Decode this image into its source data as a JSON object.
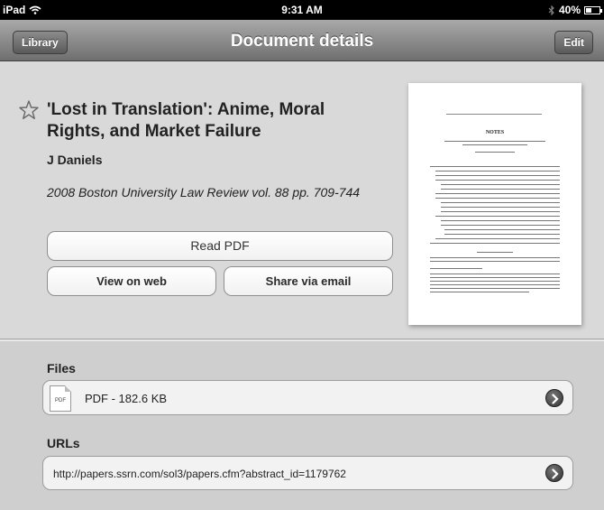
{
  "status_bar": {
    "device": "iPad",
    "time": "9:31 AM",
    "battery_text": "40%",
    "battery_level": 0.4
  },
  "nav": {
    "title": "Document details",
    "left_button": "Library",
    "right_button": "Edit"
  },
  "document": {
    "title": "'Lost in Translation': Anime, Moral Rights, and Market Failure",
    "author": "J Daniels",
    "source": "2008 Boston University Law Review vol. 88 pp. 709-744",
    "thumbnail_heading": "NOTES"
  },
  "actions": {
    "read_pdf": "Read PDF",
    "view_web": "View on web",
    "share_email": "Share via email"
  },
  "files": {
    "label": "Files",
    "items": [
      {
        "icon_text": "PDF",
        "text": "PDF - 182.6 KB"
      }
    ]
  },
  "urls": {
    "label": "URLs",
    "items": [
      {
        "text": "http://papers.ssrn.com/sol3/papers.cfm?abstract_id=1179762"
      }
    ]
  },
  "icons": {
    "wifi": "wifi-icon",
    "bluetooth": "bluetooth-icon",
    "battery": "battery-icon",
    "favorite": "star-icon",
    "disclosure": "chevron-right-circle-icon",
    "file": "pdf-file-icon"
  }
}
